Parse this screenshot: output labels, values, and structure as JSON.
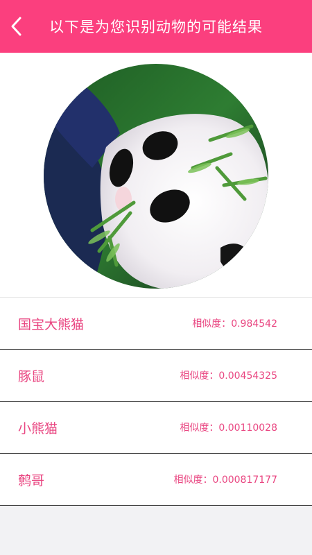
{
  "header": {
    "title": "以下是为您识别动物的可能结果",
    "back_icon": "chevron-left-icon"
  },
  "colors": {
    "accent": "#fb3f7e",
    "result_text": "#e94681",
    "background": "#f2f2f4"
  },
  "results": [
    {
      "name": "国宝大熊猫",
      "score_label": "相似度：",
      "score": "0.984542"
    },
    {
      "name": "豚鼠",
      "score_label": "相似度：",
      "score": "0.00454325"
    },
    {
      "name": "小熊猫",
      "score_label": "相似度：",
      "score": "0.00110028"
    },
    {
      "name": "鹩哥",
      "score_label": "相似度：",
      "score": "0.000817177"
    }
  ]
}
